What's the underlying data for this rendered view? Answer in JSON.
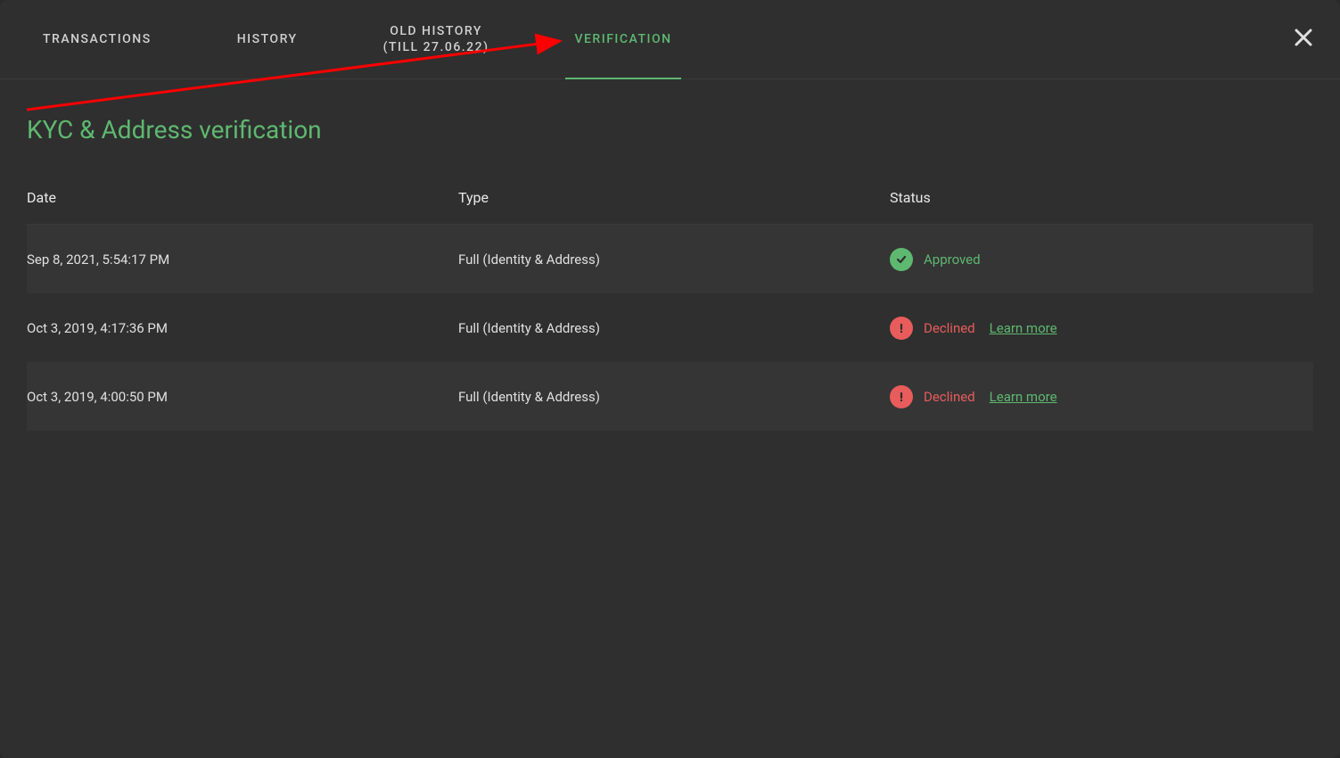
{
  "tabs": [
    {
      "label": "TRANSACTIONS",
      "active": false
    },
    {
      "label": "HISTORY",
      "active": false
    },
    {
      "label_line1": "OLD HISTORY",
      "label_line2": "(TILL 27.06.22)",
      "active": false
    },
    {
      "label": "VERIFICATION",
      "active": true
    }
  ],
  "page_title": "KYC & Address verification",
  "columns": {
    "date": "Date",
    "type": "Type",
    "status": "Status"
  },
  "rows": [
    {
      "date": "Sep 8, 2021, 5:54:17 PM",
      "type": "Full (Identity & Address)",
      "status": "Approved",
      "status_kind": "approved",
      "learn_more": null
    },
    {
      "date": "Oct 3, 2019, 4:17:36 PM",
      "type": "Full (Identity & Address)",
      "status": "Declined",
      "status_kind": "declined",
      "learn_more": "Learn more"
    },
    {
      "date": "Oct 3, 2019, 4:00:50 PM",
      "type": "Full (Identity & Address)",
      "status": "Declined",
      "status_kind": "declined",
      "learn_more": "Learn more"
    }
  ],
  "colors": {
    "accent_green": "#5eb870",
    "accent_red": "#e85c5c",
    "bg_dark": "#2f2f2f",
    "bg_row_alt": "#353535"
  }
}
